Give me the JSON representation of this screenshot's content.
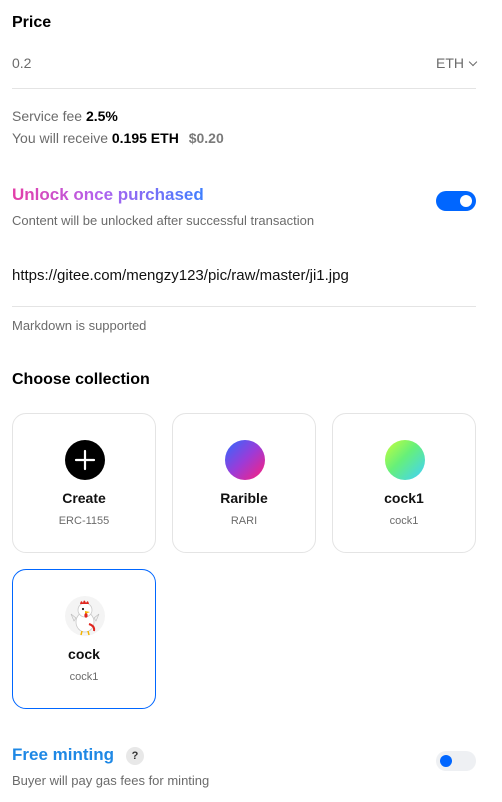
{
  "price": {
    "heading": "Price",
    "value": "0.2",
    "currency": "ETH"
  },
  "fees": {
    "service_label": "Service fee",
    "service_value": "2.5%",
    "receive_label": "You will receive",
    "receive_amount": "0.195 ETH",
    "receive_usd": "$0.20"
  },
  "unlock": {
    "title": "Unlock once purchased",
    "description": "Content will be unlocked after successful transaction",
    "enabled": true,
    "content": "https://gitee.com/mengzy123/pic/raw/master/ji1.jpg",
    "hint": "Markdown is supported"
  },
  "collection": {
    "heading": "Choose collection",
    "items": [
      {
        "name": "Create",
        "sub": "ERC-1155",
        "icon": "plus-icon"
      },
      {
        "name": "Rarible",
        "sub": "RARI",
        "icon": "rarible-gradient-avatar"
      },
      {
        "name": "cock1",
        "sub": "cock1",
        "icon": "green-gradient-avatar"
      },
      {
        "name": "cock",
        "sub": "cock1",
        "icon": "rooster-avatar",
        "selected": true
      }
    ]
  },
  "free_minting": {
    "title": "Free minting",
    "help": "?",
    "description": "Buyer will pay gas fees for minting",
    "enabled": false
  },
  "colors": {
    "accent": "#0066ff",
    "free_minting_title": "#1e88e5"
  }
}
